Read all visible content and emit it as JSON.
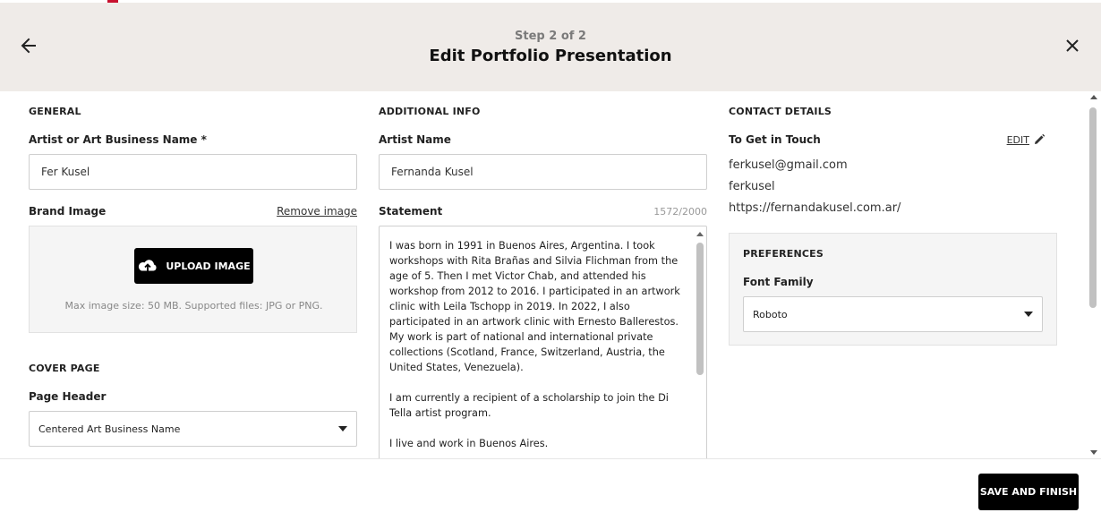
{
  "header": {
    "step": "Step 2 of 2",
    "title": "Edit Portfolio Presentation",
    "back_icon": "arrow-left-icon",
    "close_icon": "close-icon"
  },
  "general": {
    "section_title": "GENERAL",
    "business_name_label": "Artist or Art Business Name *",
    "business_name_value": "Fer Kusel",
    "brand_image_label": "Brand Image",
    "remove_image_label": "Remove image",
    "upload_button_label": "UPLOAD IMAGE",
    "upload_hint": "Max image size: 50 MB. Supported files: JPG or PNG."
  },
  "cover_page": {
    "section_title": "COVER PAGE",
    "page_header_label": "Page Header",
    "page_header_value": "Centered Art Business Name"
  },
  "additional_info": {
    "section_title": "ADDITIONAL INFO",
    "artist_name_label": "Artist Name",
    "artist_name_value": "Fernanda Kusel",
    "statement_label": "Statement",
    "statement_counter": "1572/2000",
    "statement_text": "I was born in 1991 in Buenos Aires, Argentina. I took workshops with Rita Brañas and Silvia Flichman from the age of 5. Then I met Victor Chab, and attended his workshop from 2012 to 2016. I participated in an artwork clinic with Leila Tschopp in 2019. In 2022, I also participated in an artwork clinic with Ernesto Ballerestos. My work is part of national and international private collections (Scotland, France, Switzerland, Austria, the United States, Venezuela).\n\nI am currently a recipient of a scholarship to join the Di Tella artist program.\n\nI live and work in Buenos Aires."
  },
  "contact": {
    "section_title": "CONTACT DETAILS",
    "get_in_touch_label": "To Get in Touch",
    "edit_label": "EDIT",
    "email": "ferkusel@gmail.com",
    "handle": "ferkusel",
    "website": "https://fernandakusel.com.ar/"
  },
  "preferences": {
    "section_title": "PREFERENCES",
    "font_family_label": "Font Family",
    "font_family_value": "Roboto"
  },
  "footer": {
    "save_label": "SAVE AND FINISH"
  },
  "colors": {
    "header_bg": "#efebe8",
    "primary_button": "#000000",
    "panel_bg": "#f5f5f5"
  }
}
